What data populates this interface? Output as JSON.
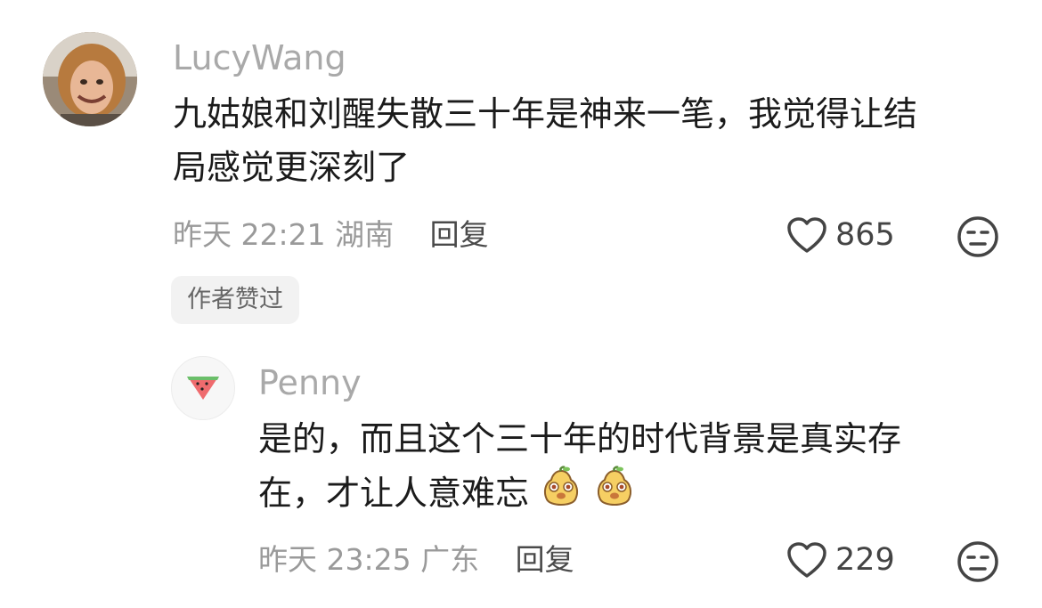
{
  "comment": {
    "username": "LucyWang",
    "text_line1": "九姑娘和刘醒失散三十年是神来一笔，我觉得让结",
    "text_line2": "局感觉更深刻了",
    "date": "昨天",
    "time": "22:21",
    "location": "湖南",
    "reply_label": "回复",
    "likes": "865",
    "author_badge": "作者赞过"
  },
  "reply": {
    "username": "Penny",
    "text_line1": "是的，而且这个三十年的时代背景是真实存",
    "text_line2": "在，才让人意难忘",
    "date": "昨天",
    "time": "23:25",
    "location": "广东",
    "reply_label": "回复",
    "likes": "229"
  },
  "icons": {
    "like": "heart-outline-icon",
    "dislike": "unamused-face-icon",
    "avatar_reply": "watermelon-icon",
    "inline_emoji": "cute-pear-face-emoji"
  },
  "colors": {
    "username": "#a9a9a9",
    "text": "#1b1b1b",
    "meta": "#9a9a9a",
    "badge_bg": "#f2f2f2"
  }
}
